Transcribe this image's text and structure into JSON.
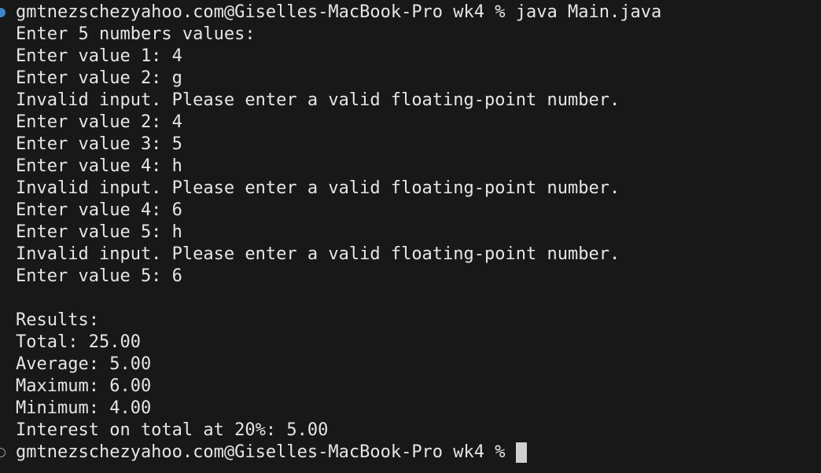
{
  "terminal": {
    "command_prompt": "gmtnezschezyahoo.com@Giselles-MacBook-Pro wk4 % java Main.java",
    "lines": [
      "Enter 5 numbers values:",
      "Enter value 1: 4",
      "Enter value 2: g",
      "Invalid input. Please enter a valid floating-point number.",
      "Enter value 2: 4",
      "Enter value 3: 5",
      "Enter value 4: h",
      "Invalid input. Please enter a valid floating-point number.",
      "Enter value 4: 6",
      "Enter value 5: h",
      "Invalid input. Please enter a valid floating-point number.",
      "Enter value 5: 6",
      "",
      "Results:",
      "Total: 25.00",
      "Average: 5.00",
      "Maximum: 6.00",
      "Minimum: 4.00",
      "Interest on total at 20%: 5.00"
    ],
    "final_prompt": "gmtnezschezyahoo.com@Giselles-MacBook-Pro wk4 % "
  },
  "colors": {
    "background": "#181818",
    "text": "#e6e6e6",
    "command_decoration": "#3f86c6",
    "cursor": "#d0d0d0"
  }
}
